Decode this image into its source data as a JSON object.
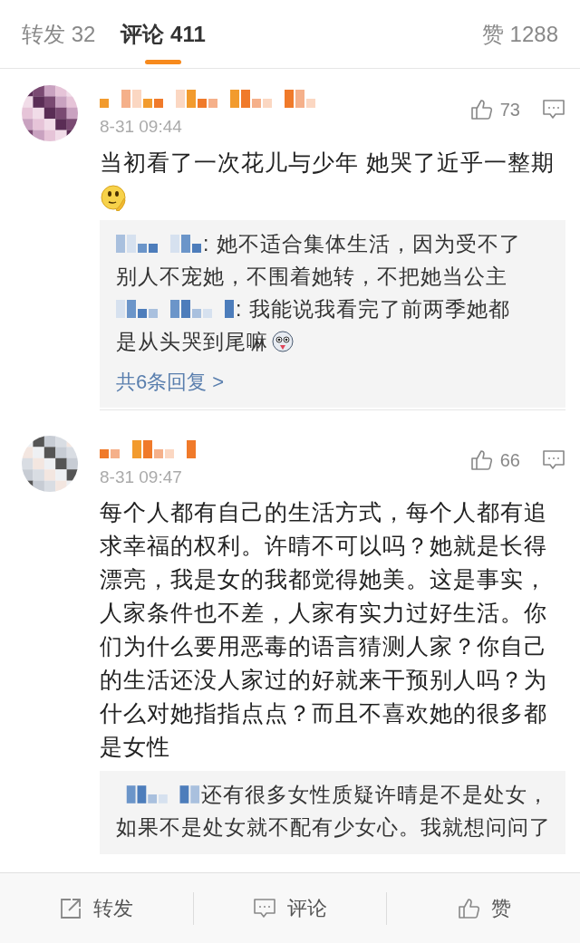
{
  "tabs": [
    {
      "label": "转发 32",
      "selected": false
    },
    {
      "label": "评论 411",
      "selected": true
    }
  ],
  "likes_total": "赞 1288",
  "comments": [
    {
      "time": "8-31 09:44",
      "likes": "73",
      "text": "当初看了一次花儿与少年 她哭了近乎一整期",
      "emoji": {
        "kind": "thinking"
      },
      "replies": [
        {
          "lines": [
            ": 她不适合集体生活，因为受不了",
            "别人不宠她，不围着她转，不把她当公主"
          ]
        },
        {
          "lines": [
            ": 我能说我看完了前两季她都",
            "是从头哭到尾嘛"
          ],
          "emoji": {
            "kind": "husky"
          }
        }
      ],
      "more": "共6条回复 >"
    },
    {
      "time": "8-31 09:47",
      "likes": "66",
      "text": "每个人都有自己的生活方式，每个人都有追求幸福的权利。许晴不可以吗？她就是长得漂亮，我是女的我都觉得她美。这是事实，人家条件也不差，人家有实力过好生活。你们为什么要用恶毒的语言猜测人家？你自己的生活还没人家过的好就来干预别人吗？为什么对她指指点点？而且不喜欢她的很多都是女性",
      "replies": [
        {
          "lines": [
            "还有很多女性质疑许晴是不是处女，",
            "如果不是处女就不配有少女心。我就想问问了"
          ]
        }
      ]
    }
  ],
  "actions": [
    {
      "kind": "repost",
      "label": "转发"
    },
    {
      "kind": "comment",
      "label": "评论"
    },
    {
      "kind": "like",
      "label": "赞"
    }
  ]
}
